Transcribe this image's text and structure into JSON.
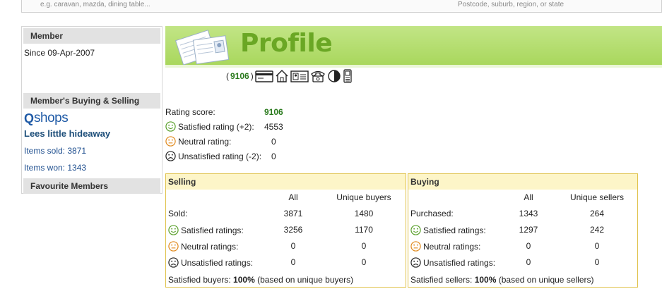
{
  "search": {
    "keyword_placeholder": "e.g. caravan, mazda, dining table...",
    "location_placeholder": "Postcode, suburb, region, or state"
  },
  "sidebar": {
    "member_heading": "Member",
    "since_text": "Since 09-Apr-2007",
    "buying_selling_heading": "Member's Buying & Selling",
    "shops_logo_q": "Q",
    "shops_logo_text": "shops",
    "store_name": "Lees little hideaway",
    "items_sold": "Items sold: 3871",
    "items_won": "Items won: 1343",
    "favourite_heading": "Favourite Members"
  },
  "banner": {
    "title": "Profile"
  },
  "score_line": {
    "open": "(",
    "value": "9106",
    "close": ")"
  },
  "verification_icons": [
    "credit-card-icon",
    "home-icon",
    "id-card-icon",
    "phone-icon",
    "contrast-icon",
    "mobile-phone-icon"
  ],
  "ratings": {
    "score_label": "Rating score:",
    "score_value": "9106",
    "satisfied_label": "Satisfied rating (+2):",
    "satisfied_value": "4553",
    "neutral_label": "Neutral rating:",
    "neutral_value": "0",
    "unsatisfied_label": "Unsatisfied rating (-2):",
    "unsatisfied_value": "0"
  },
  "selling": {
    "heading": "Selling",
    "col_all": "All",
    "col_unique": "Unique buyers",
    "rows": [
      {
        "label": "Sold:",
        "all": "3871",
        "unique": "1480",
        "icon": ""
      },
      {
        "label": "Satisfied ratings:",
        "all": "3256",
        "unique": "1170",
        "icon": "smile"
      },
      {
        "label": "Neutral ratings:",
        "all": "0",
        "unique": "0",
        "icon": "neutral"
      },
      {
        "label": "Unsatisfied ratings:",
        "all": "0",
        "unique": "0",
        "icon": "frown"
      }
    ],
    "footer_prefix": "Satisfied buyers: ",
    "footer_percent": "100%",
    "footer_suffix": " (based on unique buyers)"
  },
  "buying": {
    "heading": "Buying",
    "col_all": "All",
    "col_unique": "Unique sellers",
    "rows": [
      {
        "label": "Purchased:",
        "all": "1343",
        "unique": "264",
        "icon": ""
      },
      {
        "label": "Satisfied ratings:",
        "all": "1297",
        "unique": "242",
        "icon": "smile"
      },
      {
        "label": "Neutral ratings:",
        "all": "0",
        "unique": "0",
        "icon": "neutral"
      },
      {
        "label": "Unsatisfied ratings:",
        "all": "0",
        "unique": "0",
        "icon": "frown"
      }
    ],
    "footer_prefix": "Satisfied sellers: ",
    "footer_percent": "100%",
    "footer_suffix": " (based on unique sellers)"
  },
  "colors": {
    "banner_green": "#a9d75d",
    "title_green": "#6aa724",
    "score_green": "#2a7a1d",
    "panel_border": "#e0c24a",
    "panel_head": "#fdf5c8",
    "smile_green": "#5aa02c",
    "neutral_orange": "#e08a1e",
    "frown_black": "#222222"
  }
}
